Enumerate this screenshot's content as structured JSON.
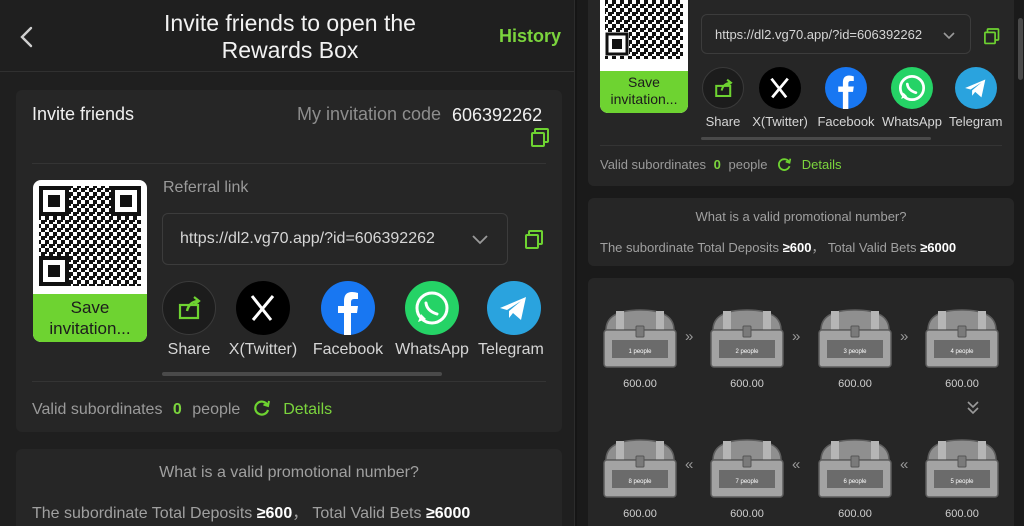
{
  "header": {
    "title_line1": "Invite friends to open the",
    "title_line2": "Rewards Box",
    "history": "History"
  },
  "invite": {
    "section_title": "Invite friends",
    "code_label": "My invitation code",
    "code_value": "606392262",
    "referral_label": "Referral link",
    "referral_url": "https://dl2.vg70.app/?id=606392262",
    "save_line1": "Save",
    "save_line2": "invitation..."
  },
  "share": [
    {
      "label": "Share",
      "icon": "share-icon"
    },
    {
      "label": "X(Twitter)",
      "icon": "x-twitter-icon"
    },
    {
      "label": "Facebook",
      "icon": "facebook-icon"
    },
    {
      "label": "WhatsApp",
      "icon": "whatsapp-icon"
    },
    {
      "label": "Telegram",
      "icon": "telegram-icon"
    }
  ],
  "subordinates": {
    "label": "Valid subordinates",
    "count": "0",
    "unit": "people",
    "details": "Details"
  },
  "promo": {
    "question": "What is a valid promotional number?",
    "deposits_label": "The subordinate Total Deposits",
    "deposits_value": "≥600",
    "separator": "，",
    "bets_label": "Total Valid Bets",
    "bets_value": "≥6000"
  },
  "chests": [
    {
      "people": "1 people",
      "value": "600.00"
    },
    {
      "people": "2 people",
      "value": "600.00"
    },
    {
      "people": "3 people",
      "value": "600.00"
    },
    {
      "people": "4 people",
      "value": "600.00"
    },
    {
      "people": "5 people",
      "value": "600.00"
    },
    {
      "people": "6 people",
      "value": "600.00"
    },
    {
      "people": "7 people",
      "value": "600.00"
    },
    {
      "people": "8 people",
      "value": "600.00"
    }
  ],
  "arrows": {
    "right": "»",
    "left": "«",
    "down": "⌄⌄"
  },
  "colors": {
    "accent": "#6ed331",
    "facebook": "#1877f2",
    "whatsapp": "#25d366",
    "telegram": "#2aa3de",
    "x": "#000000"
  }
}
